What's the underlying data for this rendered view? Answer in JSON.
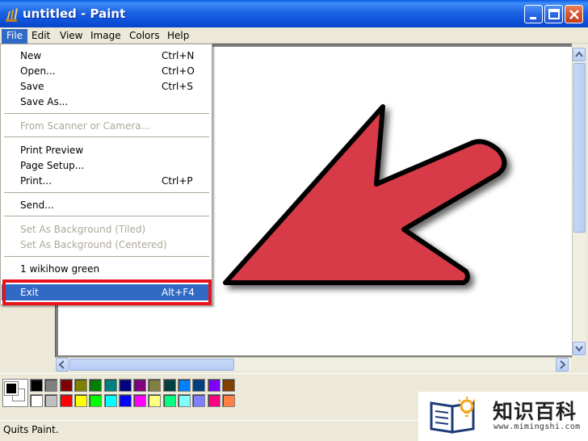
{
  "window": {
    "title": "untitled - Paint",
    "buttons": {
      "minimize": "minimize-icon",
      "maximize": "maximize-icon",
      "close": "close-icon"
    }
  },
  "menubar": {
    "items": [
      {
        "label": "File",
        "active": true
      },
      {
        "label": "Edit"
      },
      {
        "label": "View"
      },
      {
        "label": "Image"
      },
      {
        "label": "Colors"
      },
      {
        "label": "Help"
      }
    ]
  },
  "file_menu": {
    "items": [
      {
        "label": "New",
        "shortcut": "Ctrl+N"
      },
      {
        "label": "Open...",
        "shortcut": "Ctrl+O"
      },
      {
        "label": "Save",
        "shortcut": "Ctrl+S"
      },
      {
        "label": "Save As...",
        "shortcut": ""
      },
      {
        "label": "From Scanner or Camera...",
        "shortcut": "",
        "disabled": true
      },
      {
        "label": "Print Preview",
        "shortcut": ""
      },
      {
        "label": "Page Setup...",
        "shortcut": ""
      },
      {
        "label": "Print...",
        "shortcut": "Ctrl+P"
      },
      {
        "label": "Send...",
        "shortcut": ""
      },
      {
        "label": "Set As Background (Tiled)",
        "shortcut": "",
        "disabled": true
      },
      {
        "label": "Set As Background (Centered)",
        "shortcut": "",
        "disabled": true
      },
      {
        "label": "1 wikihow green",
        "shortcut": ""
      },
      {
        "label": "Exit",
        "shortcut": "Alt+F4",
        "highlighted": true
      }
    ]
  },
  "palette": {
    "top_row": [
      "#000000",
      "#808080",
      "#800000",
      "#808000",
      "#008000",
      "#008080",
      "#000080",
      "#800080",
      "#808040",
      "#004040",
      "#0080ff",
      "#004080",
      "#8000ff",
      "#804000"
    ],
    "bottom_row": [
      "#ffffff",
      "#c0c0c0",
      "#ff0000",
      "#ffff00",
      "#00ff00",
      "#00ffff",
      "#0000ff",
      "#ff00ff",
      "#ffff80",
      "#00ff80",
      "#80ffff",
      "#8080ff",
      "#ff0080",
      "#ff8040"
    ],
    "foreground": "#000000",
    "background": "#ffffff"
  },
  "canvas": {
    "arrow_color": "#d63a47"
  },
  "status": {
    "text": "Quits Paint."
  },
  "watermark": {
    "title": "知识百科",
    "url": "www.mimingshi.com"
  },
  "colors": {
    "highlight": "#316ac5",
    "callout": "#e8141c"
  }
}
